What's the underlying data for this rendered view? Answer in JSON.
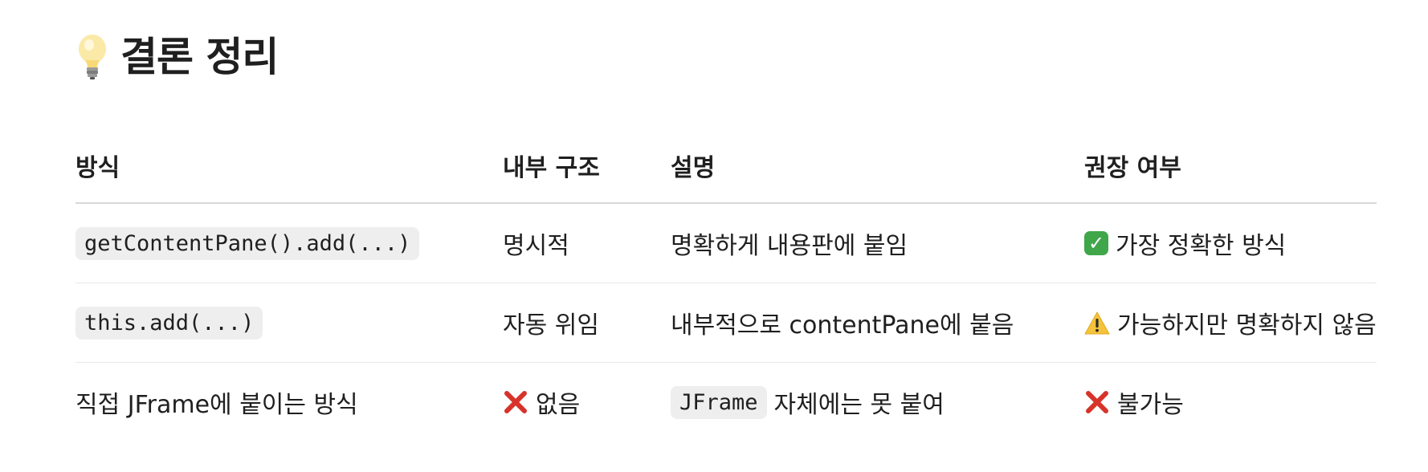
{
  "title": {
    "icon": "lightbulb-icon",
    "text": "결론 정리"
  },
  "table": {
    "headers": [
      "방식",
      "내부 구조",
      "설명",
      "권장 여부"
    ],
    "rows": [
      {
        "method": "getContentPane().add(...)",
        "method_is_code": true,
        "structure": "명시적",
        "desc_code": "",
        "description": "명확하게 내용판에 붙임",
        "recommend_icon": "check-mark-icon",
        "recommend": "가장 정확한 방식"
      },
      {
        "method": "this.add(...)",
        "method_is_code": true,
        "structure": "자동 위임",
        "desc_code": "",
        "description": "내부적으로 contentPane에 붙음",
        "recommend_icon": "warning-icon",
        "recommend": "가능하지만 명확하지 않음"
      },
      {
        "method": "직접 JFrame에 붙이는 방식",
        "method_is_code": false,
        "structure_icon": "cross-mark-icon",
        "structure": "없음",
        "desc_code": "JFrame",
        "description": "자체에는 못 붙여",
        "recommend_icon": "cross-mark-icon",
        "recommend": "불가능"
      }
    ]
  },
  "colors": {
    "text": "#1f1f1f",
    "code_bg": "#eeeeee",
    "check_green": "#3fa64a",
    "cross_red": "#d7332b",
    "warning_yellow": "#f5c33b",
    "divider": "#e8e8e8"
  }
}
